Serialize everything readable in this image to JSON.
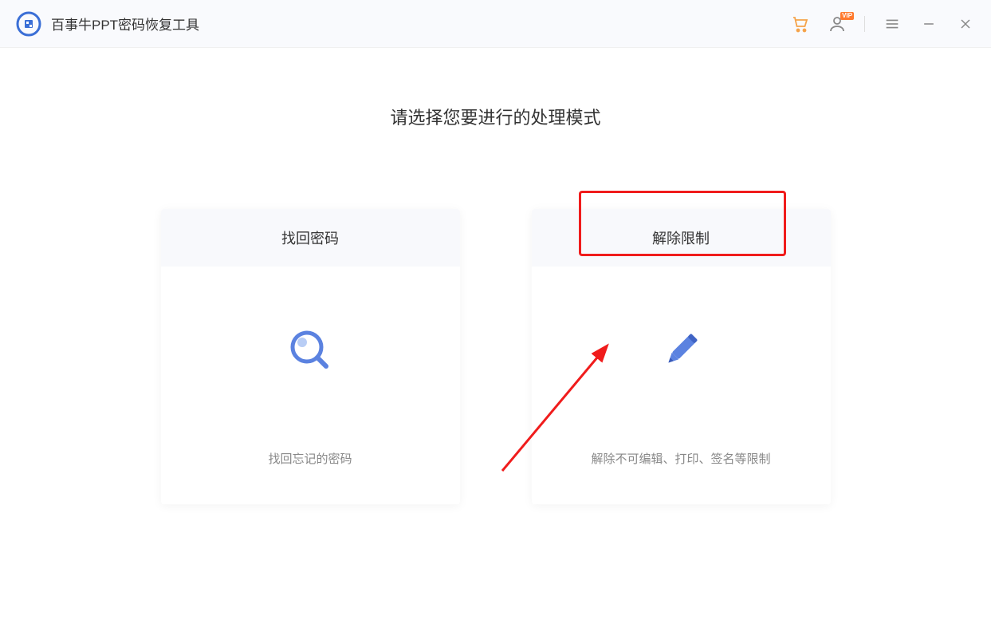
{
  "app": {
    "title": "百事牛PPT密码恢复工具"
  },
  "main": {
    "prompt": "请选择您要进行的处理模式",
    "cards": [
      {
        "title": "找回密码",
        "description": "找回忘记的密码"
      },
      {
        "title": "解除限制",
        "description": "解除不可编辑、打印、签名等限制"
      }
    ]
  },
  "user": {
    "badge": "VIP"
  }
}
